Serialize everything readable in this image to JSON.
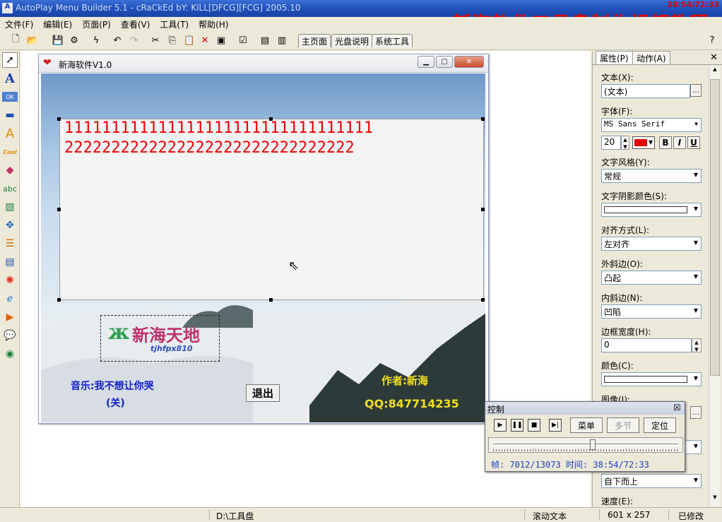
{
  "titlebar": {
    "app_title": "AutoPlay Menu Builder 5.1 - cRaCkEd bY: KiLL[DFCG][FCG] 2005.10",
    "overlay_title": "新海软件工具盘制作视频教程",
    "timestamp": "38:54/72:33"
  },
  "menubar": [
    "文件(F)",
    "编辑(E)",
    "页面(P)",
    "查看(V)",
    "工具(T)",
    "帮助(H)"
  ],
  "tabs": [
    "主页面",
    "光盘说明",
    "系统工具"
  ],
  "window": {
    "title": "新海软件V1.0",
    "line1": "111111111111111111111111111111111",
    "line2": "2222222222222222222222222222222",
    "logo_text": "新海天地",
    "logo_sub": "tjhfpx810",
    "music": "音乐:我不想让你哭",
    "music_off": "(关)",
    "exit": "退出",
    "author": "作者:新海",
    "qq": "QQ:847714235"
  },
  "panel": {
    "tab_props": "属性(P)",
    "tab_actions": "动作(A)",
    "text_label": "文本(X):",
    "text_value": "(文本)",
    "font_label": "字体(F):",
    "font_value": "MS Sans Serif",
    "font_size": "20",
    "bold": "B",
    "italic": "I",
    "underline": "U",
    "style_label": "文字风格(Y):",
    "style_value": "常规",
    "shadow_label": "文字阴影颜色(S):",
    "align_label": "对齐方式(L):",
    "align_value": "左对齐",
    "outer_label": "外斜边(O):",
    "outer_value": "凸起",
    "inner_label": "内斜边(N):",
    "inner_value": "凹陷",
    "border_label": "边框宽度(H):",
    "border_value": "0",
    "color_label": "颜色(C):",
    "image_label": "图像(I):",
    "direction_value": "自下而上",
    "speed_label": "速度(E):"
  },
  "control": {
    "title": "控制",
    "menu": "菜单",
    "multi": "多节",
    "locate": "定位",
    "info": "帧: 7012/13073 时间: 38:54/72:33",
    "progress": 0.54
  },
  "status": {
    "path": "D:\\工具盘",
    "type": "滚动文本",
    "size": "601 x 257",
    "state": "已修改"
  },
  "colors": {
    "red": "#e00000",
    "blue": "#1020c8",
    "yellow": "#f0e020"
  }
}
